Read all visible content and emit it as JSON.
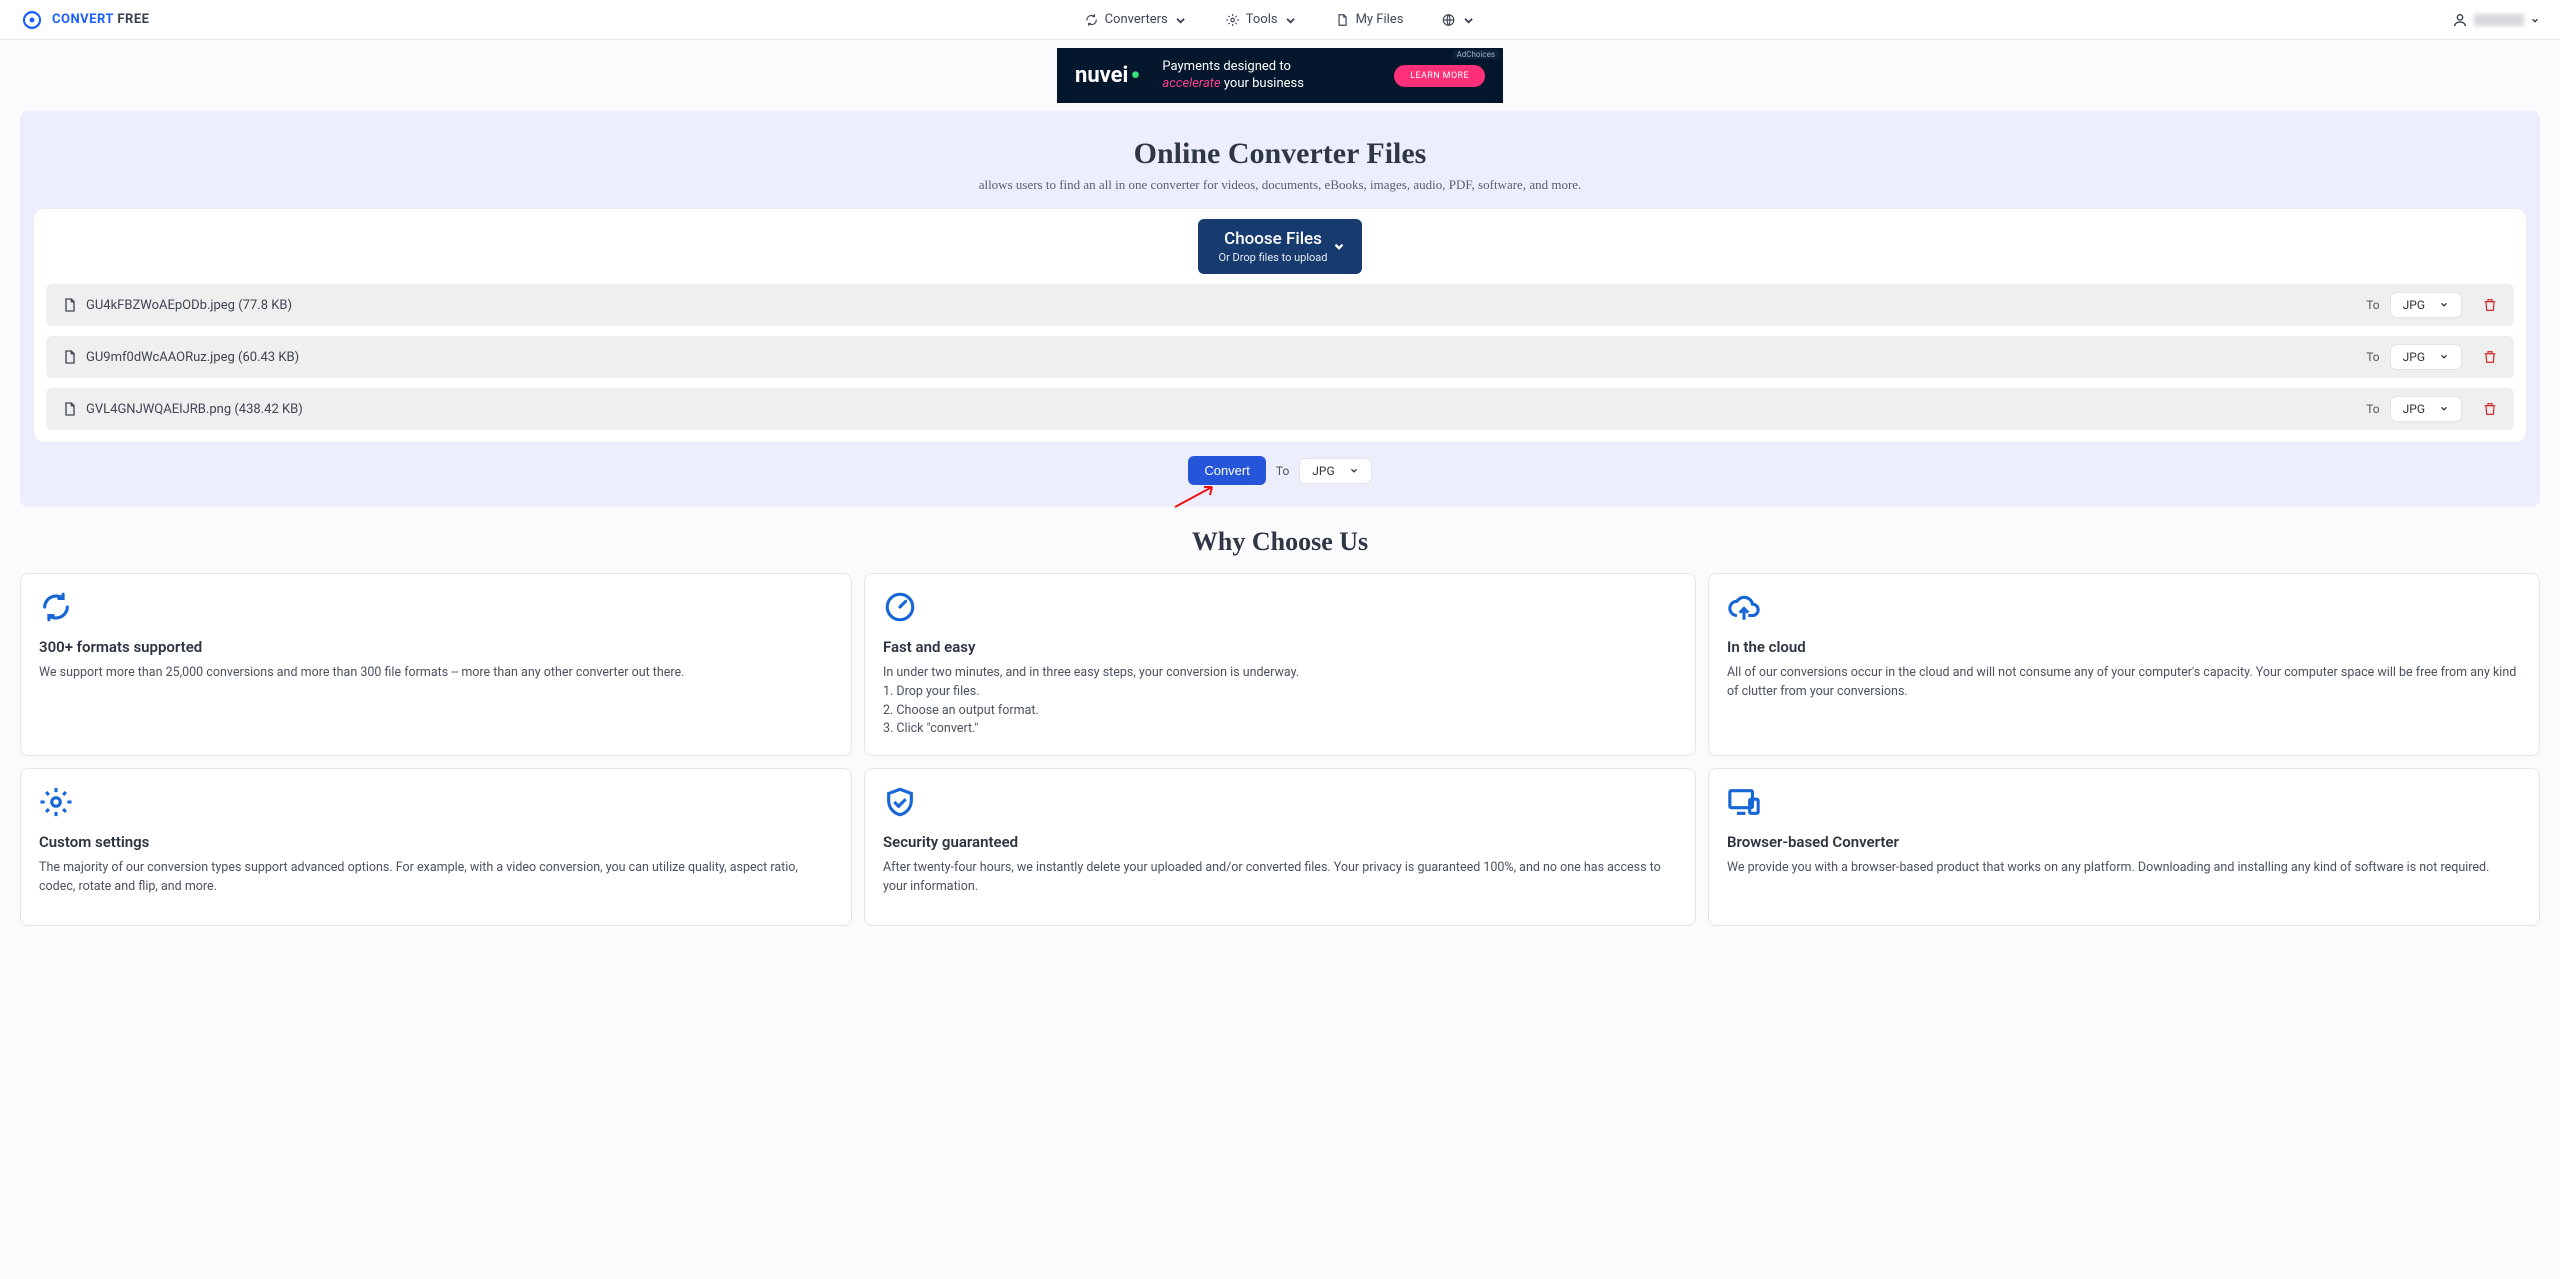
{
  "brand": {
    "part1": "CONVERT",
    "part2": "FREE"
  },
  "nav": {
    "converters": "Converters",
    "tools": "Tools",
    "myfiles": "My Files"
  },
  "ad": {
    "brand": "nuvei",
    "line1": "Payments designed to",
    "italic": "accelerate",
    "line2rest": " your business",
    "cta": "LEARN MORE",
    "badge": "AdChoices"
  },
  "hero": {
    "title": "Online Converter Files",
    "sub": "allows users to find an all in one converter for videos, documents, eBooks, images, audio, PDF, software, and more."
  },
  "choose": {
    "main": "Choose Files",
    "sub": "Or Drop files to upload"
  },
  "files": [
    {
      "name": "GU4kFBZWoAEpODb.jpeg (77.8 KB)",
      "to": "To",
      "fmt": "JPG"
    },
    {
      "name": "GU9mf0dWcAAORuz.jpeg (60.43 KB)",
      "to": "To",
      "fmt": "JPG"
    },
    {
      "name": "GVL4GNJWQAEIJRB.png (438.42 KB)",
      "to": "To",
      "fmt": "JPG"
    }
  ],
  "convert": {
    "button": "Convert",
    "to": "To",
    "fmt": "JPG"
  },
  "why_title": "Why Choose Us",
  "features": [
    {
      "title": "300+ formats supported",
      "body": "We support more than 25,000 conversions and more than 300 file formats -- more than any other converter out there."
    },
    {
      "title": "Fast and easy",
      "body": "In under two minutes, and in three easy steps, your conversion is underway.\n1. Drop your files.\n2. Choose an output format.\n3. Click \"convert.\""
    },
    {
      "title": "In the cloud",
      "body": "All of our conversions occur in the cloud and will not consume any of your computer's capacity. Your computer space will be free from any kind of clutter from your conversions."
    },
    {
      "title": "Custom settings",
      "body": "The majority of our conversion types support advanced options. For example, with a video conversion, you can utilize quality, aspect ratio, codec, rotate and flip, and more."
    },
    {
      "title": "Security guaranteed",
      "body": "After twenty-four hours, we instantly delete your uploaded and/or converted files. Your privacy is guaranteed 100%, and no one has access to your information."
    },
    {
      "title": "Browser-based Converter",
      "body": "We provide you with a browser-based product that works on any platform. Downloading and installing any kind of software is not required."
    }
  ]
}
